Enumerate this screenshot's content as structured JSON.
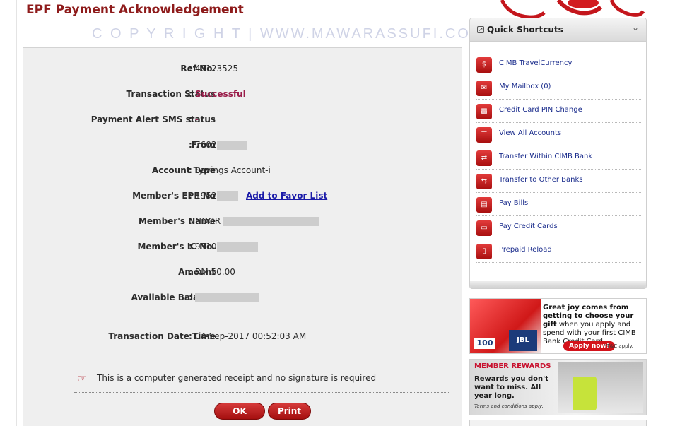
{
  "page": {
    "title": "EPF Payment Acknowledgement",
    "watermark": "C O P Y R I G H T | WWW.MAWARASSUFI.COM"
  },
  "receipt": {
    "fields": [
      {
        "label": "Ref No.",
        "value": "40123525"
      },
      {
        "label": "Transaction Status",
        "value": "Successful"
      },
      {
        "label": "Payment Alert SMS status",
        "value": "-"
      },
      {
        "label": "From",
        "value": "7602"
      },
      {
        "label": "Account Type",
        "value": "Savings Account-i"
      },
      {
        "label": "Member's EPF No",
        "value": "1952"
      },
      {
        "label": "Member's Name",
        "value": "NOOR"
      },
      {
        "label": "Member's IC No.",
        "value": "9310"
      },
      {
        "label": "Amount",
        "value": "RM 50.00"
      },
      {
        "label": "Available Balance",
        "value": ""
      },
      {
        "label": "Transaction Date Time",
        "value": "04-Sep-2017 00:52:03 AM"
      }
    ],
    "separator": ":",
    "favor_link": "Add to Favor List",
    "note": "This is a computer generated receipt and no signature is required",
    "buttons": {
      "ok": "OK",
      "print": "Print"
    }
  },
  "shortcuts": {
    "title": "Quick Shortcuts",
    "items": [
      {
        "label": "CIMB TravelCurrency",
        "icon": "globe-currency-icon"
      },
      {
        "label": "My Mailbox  (0)",
        "icon": "mailbox-icon"
      },
      {
        "label": "Credit Card PIN Change",
        "icon": "credit-card-pin-icon"
      },
      {
        "label": "View All Accounts",
        "icon": "accounts-list-icon"
      },
      {
        "label": "Transfer Within CIMB Bank",
        "icon": "transfer-icon"
      },
      {
        "label": "Transfer to Other Banks",
        "icon": "transfer-other-icon"
      },
      {
        "label": "Pay Bills",
        "icon": "bill-icon"
      },
      {
        "label": "Pay Credit Cards",
        "icon": "pay-card-icon"
      },
      {
        "label": "Prepaid Reload",
        "icon": "phone-reload-icon"
      }
    ]
  },
  "banners": {
    "gift": {
      "headline": "Great joy comes from getting to choose your gift",
      "body": "when you apply and spend with your first CIMB Bank Credit Card.",
      "apply": "Apply now!",
      "tc": "*T&C apply.",
      "badge": "100",
      "box_brand": "JBL"
    },
    "rewards": {
      "heading": "MEMBER REWARDS",
      "body": "Rewards you don't want to miss. All year long.",
      "tc": "Terms and conditions apply."
    }
  },
  "colors": {
    "brand_red": "#8e1b1b",
    "success": "#9a1d4a",
    "link": "#1a2c8c"
  }
}
